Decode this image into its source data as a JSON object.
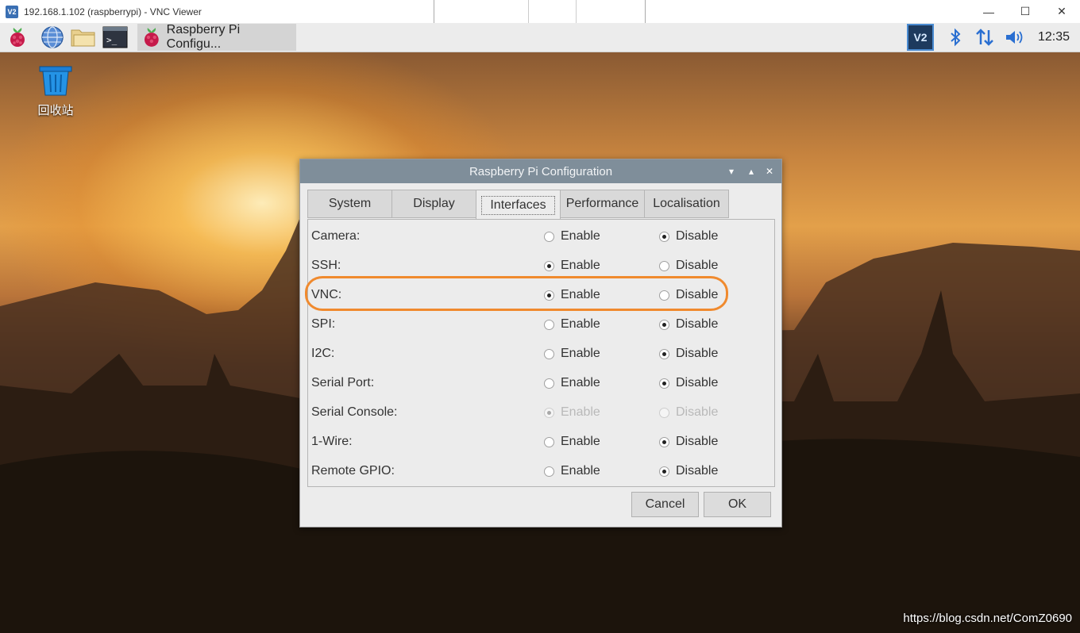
{
  "vnc_window": {
    "logo_text": "V2",
    "title": "192.168.1.102 (raspberrypi) - VNC Viewer",
    "controls": {
      "minimize": "—",
      "maximize": "☐",
      "close": "✕"
    }
  },
  "taskbar": {
    "launchers": [
      {
        "name": "raspberry-menu-icon"
      },
      {
        "name": "web-browser-icon"
      },
      {
        "name": "file-manager-icon"
      },
      {
        "name": "terminal-icon"
      }
    ],
    "task": {
      "label": "Raspberry Pi Configu..."
    },
    "tray": {
      "vnc_label": "V2",
      "clock": "12:35"
    }
  },
  "desktop": {
    "trash_label": "回收站",
    "watermark": "https://blog.csdn.net/ComZ0690"
  },
  "dialog": {
    "title": "Raspberry Pi Configuration",
    "tabs": [
      "System",
      "Display",
      "Interfaces",
      "Performance",
      "Localisation"
    ],
    "active_tab": "Interfaces",
    "enable_label": "Enable",
    "disable_label": "Disable",
    "interfaces": [
      {
        "label": "Camera:",
        "value": "Disable",
        "disabled": false
      },
      {
        "label": "SSH:",
        "value": "Enable",
        "disabled": false
      },
      {
        "label": "VNC:",
        "value": "Enable",
        "disabled": false
      },
      {
        "label": "SPI:",
        "value": "Disable",
        "disabled": false
      },
      {
        "label": "I2C:",
        "value": "Disable",
        "disabled": false
      },
      {
        "label": "Serial Port:",
        "value": "Disable",
        "disabled": false
      },
      {
        "label": "Serial Console:",
        "value": "Enable",
        "disabled": true
      },
      {
        "label": "1-Wire:",
        "value": "Disable",
        "disabled": false
      },
      {
        "label": "Remote GPIO:",
        "value": "Disable",
        "disabled": false
      }
    ],
    "cancel_label": "Cancel",
    "ok_label": "OK"
  },
  "colors": {
    "highlight": "#f08a2e",
    "dialog_titlebar": "#7f8e9a"
  }
}
